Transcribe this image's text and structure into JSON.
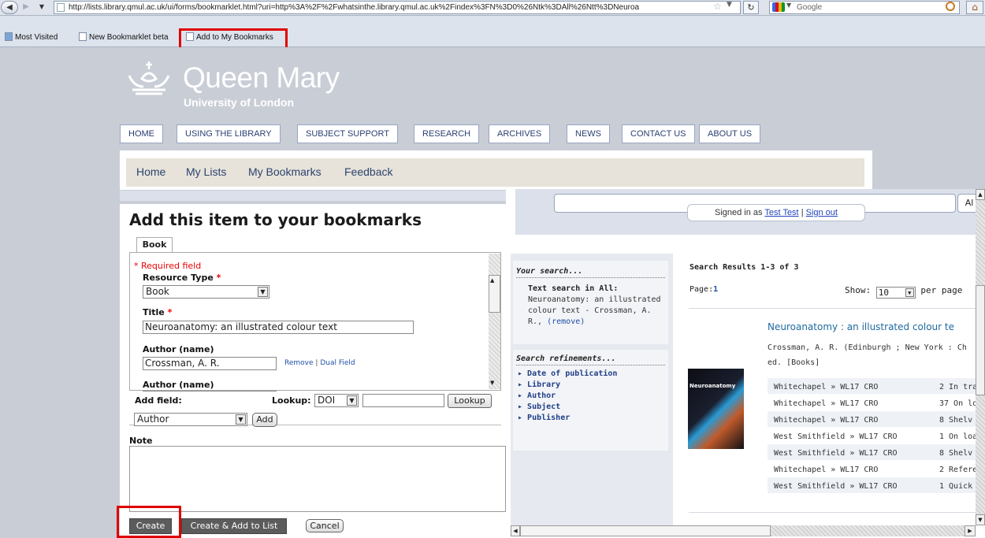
{
  "browser": {
    "url": "http://lists.library.qmul.ac.uk/ui/forms/bookmarklet.html?uri=http%3A%2F%2Fwhatsinthe.library.qmul.ac.uk%2Findex%3FN%3D0%26Ntk%3DAll%26Ntt%3DNeuroa",
    "search_engine_label": "Google",
    "back_icon": "back-arrow",
    "forward_icon": "forward-arrow",
    "reload_icon": "reload",
    "home_icon": "home"
  },
  "bookmarks_bar": {
    "items": [
      "Most Visited",
      "New Bookmarklet beta",
      "Add to My Bookmarks"
    ]
  },
  "site": {
    "logo_title": "Queen Mary",
    "logo_subtitle": "University of London",
    "nav": [
      "HOME",
      "USING THE LIBRARY",
      "SUBJECT SUPPORT",
      "RESEARCH",
      "ARCHIVES",
      "NEWS",
      "CONTACT US",
      "ABOUT US"
    ],
    "lists_nav": [
      "Home",
      "My Lists",
      "My Bookmarks",
      "Feedback"
    ]
  },
  "background_page": {
    "search_button": "Al",
    "signed_in_prefix": "Signed in as",
    "user_name": "Test Test",
    "separator": "|",
    "sign_out": "Sign out",
    "your_search_heading": "Your search...",
    "text_search_label": "Text search in All:",
    "text_search_value": "Neuroanatomy: an illustrated colour text - Crossman, A. R.,",
    "remove_link": "(remove)",
    "refinements_heading": "Search refinements...",
    "refinements": [
      "Date of publication",
      "Library",
      "Author",
      "Subject",
      "Publisher"
    ],
    "results_heading": "Search Results 1-3 of 3",
    "page_label": "Page:",
    "page_number": "1",
    "show_label": "Show:",
    "show_value": "10",
    "per_page": "per page",
    "result_title": "Neuroanatomy : an illustrated colour te",
    "result_meta_1": "Crossman, A. R. (Edinburgh ; New York : Ch",
    "result_meta_2": "ed. [Books]",
    "cover_title": "Neuroanatomy",
    "holdings": [
      {
        "location": "Whitechapel »  WL17 CRO",
        "status": "2 In tra"
      },
      {
        "location": "Whitechapel »  WL17 CRO",
        "status": "37 On lo"
      },
      {
        "location": "Whitechapel »  WL17 CRO",
        "status": "8 Shelv"
      },
      {
        "location": "West Smithfield »  WL17 CRO",
        "status": "1 On loa"
      },
      {
        "location": "West Smithfield »  WL17 CRO",
        "status": "8 Shelv"
      },
      {
        "location": "Whitechapel »  WL17 CRO",
        "status": "2 Refere"
      },
      {
        "location": "West Smithfield »  WL17 CRO",
        "status": "1 Quick"
      }
    ]
  },
  "dialog": {
    "title": "Add this item to your bookmarks",
    "tab": "Book",
    "required_note": "* Required field",
    "resource_type_label": "Resource Type",
    "required_star": "*",
    "resource_type_value": "Book",
    "title_label": "Title",
    "title_value": "Neuroanatomy: an illustrated colour text",
    "author_label": "Author (name)",
    "author_value": "Crossman, A. R.",
    "remove_link": "Remove",
    "link_sep": "|",
    "dual_field_link": "Dual Field",
    "author_label_2": "Author (name)",
    "add_field_label": "Add field:",
    "add_field_value": "Author",
    "add_button": "Add",
    "lookup_label": "Lookup:",
    "lookup_type": "DOI",
    "lookup_value": "",
    "lookup_button": "Lookup",
    "note_label": "Note",
    "note_value": "",
    "create_button": "Create",
    "create_add_button": "Create & Add to List",
    "cancel_button": "Cancel"
  },
  "colors": {
    "page_background": "#c9cdd6",
    "highlight_red": "#e00000",
    "link_blue": "#2c4470"
  }
}
